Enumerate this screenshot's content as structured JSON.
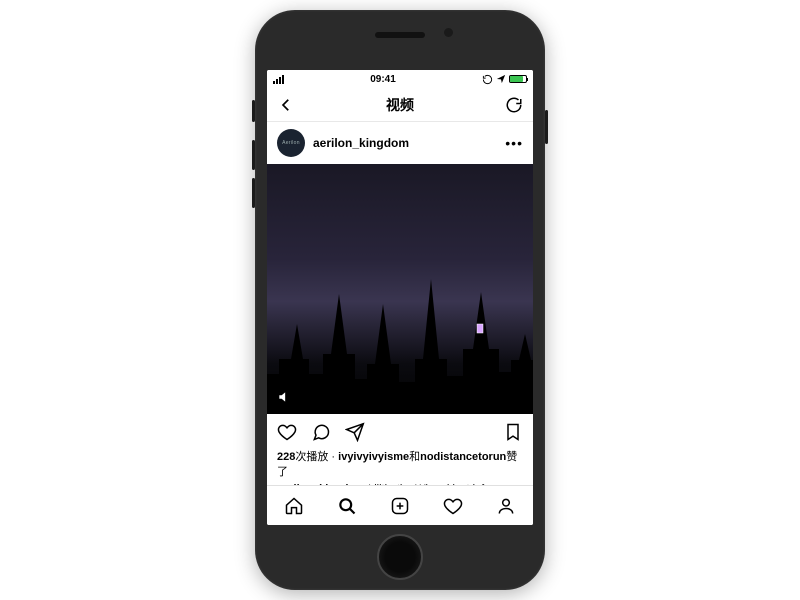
{
  "status": {
    "time": "09:41"
  },
  "nav": {
    "title": "视频"
  },
  "post": {
    "username": "aerilon_kingdom",
    "avatar_text": "Aerilon",
    "plays_count": "228",
    "plays_suffix": "次播放",
    "separator": " · ",
    "liker1": "ivyivyivyisme",
    "liker_join": "和",
    "liker2": "nodistancetorun",
    "liked_suffix": "赞了",
    "caption_user": "aerilon_kingdom",
    "caption_body": " Lilith, the Wizard just inform you about a prophecy of a magical object, powerful enough to crush your kingdom. Will you be able to find it and destroy it before it's too late? Start the"
  },
  "icons": {
    "back": "back-icon",
    "refresh": "refresh-icon",
    "more": "more-icon",
    "like": "heart-icon",
    "comment": "comment-icon",
    "share": "share-icon",
    "save": "bookmark-icon",
    "home": "home-icon",
    "search": "search-icon",
    "add": "add-icon",
    "activity": "activity-icon",
    "profile": "profile-icon",
    "audio": "audio-icon"
  }
}
